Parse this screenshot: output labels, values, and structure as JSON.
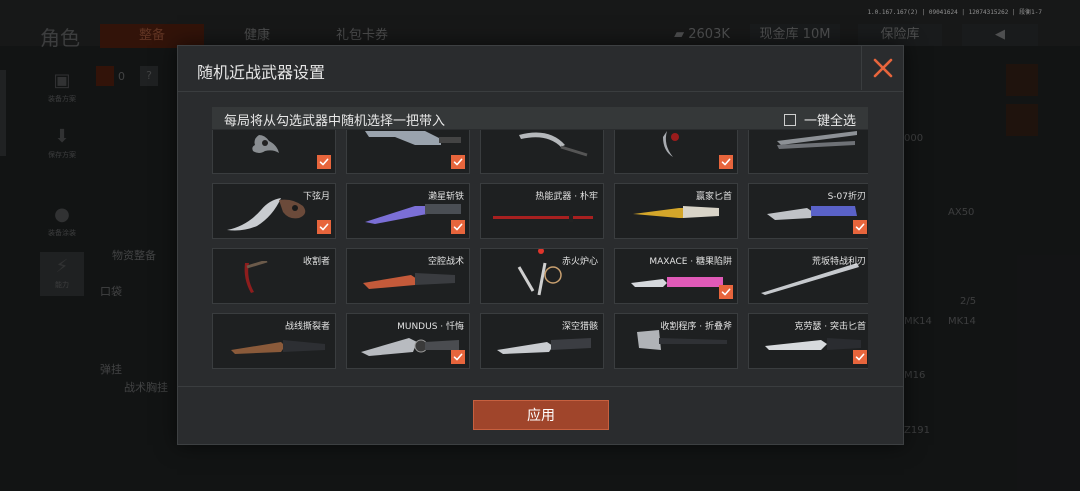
{
  "background": {
    "title": "角色",
    "tabs": [
      {
        "label": "整备",
        "active": true
      },
      {
        "label": "健康",
        "active": false
      },
      {
        "label": "礼包卡券",
        "active": false
      }
    ],
    "currency": "2603K",
    "warehouse": "现金库 10M",
    "safe": "保险库",
    "version": "1.0.167.167(2) | 09041624 | 12074315262 | 段衡1-7",
    "side_items": [
      "装备方案",
      "保存方案",
      "装备涂装",
      "能力"
    ],
    "labels": {
      "supply": "物资整备",
      "pocket": "口袋",
      "ammo": "弹挂",
      "vest": "战术胸挂",
      "count": "0",
      "help": "?"
    },
    "right_items": [
      "AX50",
      "2/5",
      "MK14",
      "MK14",
      "M16",
      "Z191",
      "000"
    ]
  },
  "modal": {
    "title": "随机近战武器设置",
    "info": "每局将从勾选武器中随机选择一把带入",
    "select_all": "一键全选",
    "apply": "应用"
  },
  "weapons": [
    {
      "name": "",
      "checked": true,
      "icon": "knuckle-knife-icon"
    },
    {
      "name": "",
      "checked": true,
      "icon": "cleaver-icon"
    },
    {
      "name": "",
      "checked": false,
      "icon": "sickle-icon"
    },
    {
      "name": "",
      "checked": true,
      "icon": "claw-knife-icon"
    },
    {
      "name": "",
      "checked": false,
      "icon": "dual-blade-icon"
    },
    {
      "name": "下弦月",
      "checked": true,
      "icon": "karambit-icon"
    },
    {
      "name": "濑星斩铁",
      "checked": true,
      "icon": "tactical-knife-icon"
    },
    {
      "name": "热能武器 · 朴牢",
      "checked": false,
      "icon": "katana-icon"
    },
    {
      "name": "赢家匕首",
      "checked": false,
      "icon": "gold-dagger-icon"
    },
    {
      "name": "S-07折刃",
      "checked": true,
      "icon": "folding-blade-icon"
    },
    {
      "name": "收割者",
      "checked": false,
      "icon": "scythe-icon"
    },
    {
      "name": "空腔战术",
      "checked": false,
      "icon": "hollow-knife-icon"
    },
    {
      "name": "赤火炉心",
      "checked": false,
      "icon": "chain-blades-icon",
      "new": true
    },
    {
      "name": "MAXACE · 糖果陷阱",
      "checked": true,
      "icon": "butterfly-knife-icon"
    },
    {
      "name": "荒坂特战利刃",
      "checked": false,
      "icon": "long-blade-icon"
    },
    {
      "name": "战线撕裂者",
      "checked": false,
      "icon": "serrated-knife-icon"
    },
    {
      "name": "MUNDUS · 忏悔",
      "checked": true,
      "icon": "ornate-knife-icon"
    },
    {
      "name": "深空猎骸",
      "checked": false,
      "icon": "hunting-knife-icon"
    },
    {
      "name": "收割程序 · 折叠斧",
      "checked": false,
      "icon": "axe-icon"
    },
    {
      "name": "克劳瑟 · 突击匕首",
      "checked": true,
      "icon": "combat-dagger-icon"
    }
  ],
  "colors": {
    "accent": "#e7653c",
    "apply_bg": "#a0452b",
    "new_dot": "#e0352b"
  }
}
